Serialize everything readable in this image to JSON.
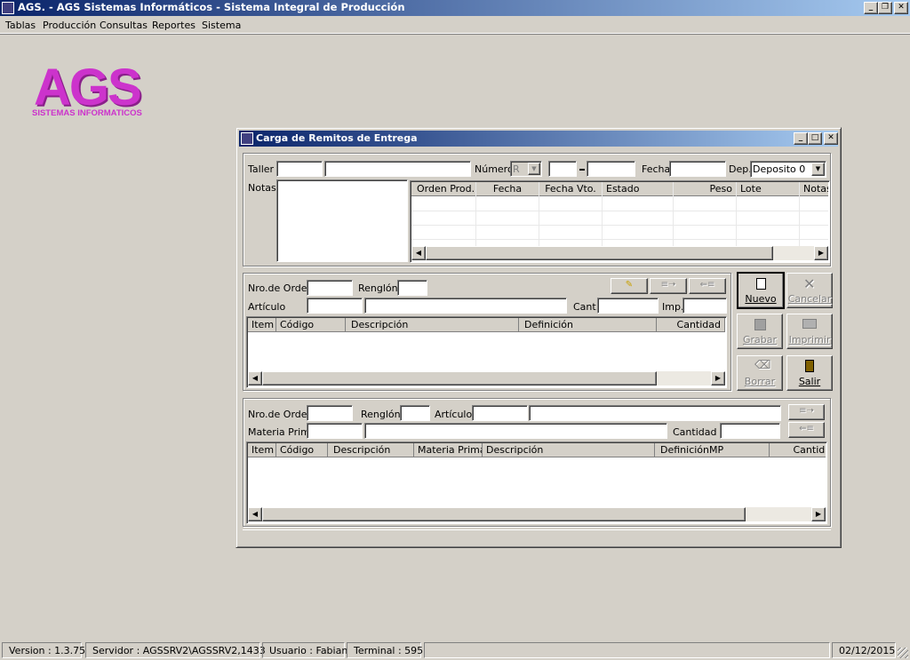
{
  "app": {
    "title": "AGS. - AGS Sistemas Informáticos - Sistema Integral de Producción",
    "logo_text": "AGS",
    "logo_subtext": "SISTEMAS INFORMATICOS"
  },
  "menu": [
    "Tablas",
    "Producción",
    "Consultas",
    "Reportes",
    "Sistema"
  ],
  "dialog": {
    "title": "Carga de Remitos de Entrega",
    "header": {
      "taller_label": "Taller",
      "numero_label": "Número",
      "numero_letter": "R",
      "fecha_label": "Fecha",
      "dep_label": "Dep.",
      "deposito_value": "Deposito 0",
      "notas_label": "Notas"
    },
    "orders_table": {
      "columns": [
        "Orden Prod.",
        "Fecha",
        "Fecha Vto.",
        "Estado",
        "Peso",
        "Lote",
        "Notas"
      ]
    },
    "items_section": {
      "orden_label": "Nro.de Orden",
      "renglon_label": "Renglón",
      "articulo_label": "Artículo",
      "cant_label": "Cant.",
      "imp_label": "Imp.",
      "columns": [
        "Item",
        "Código",
        "Descripción",
        "Definición",
        "Cantidad"
      ]
    },
    "mp_section": {
      "orden_label": "Nro.de Orden",
      "renglon_label": "Renglón",
      "articulo_label": "Artículo",
      "materia_label": "Materia Prima",
      "cantidad_label": "Cantidad",
      "columns": [
        "Item",
        "Código",
        "Descripción",
        "Materia Prima",
        "Descripción",
        "DefiniciónMP",
        "Cantida"
      ]
    },
    "buttons": {
      "nuevo": "Nuevo",
      "cancelar": "Cancelar",
      "grabar": "Grabar",
      "imprimir": "Imprimir",
      "borrar": "Borrar",
      "salir": "Salir"
    }
  },
  "status": {
    "version": "Version : 1.3.75",
    "servidor": "Servidor : AGSSRV2\\AGSSRV2,1433",
    "usuario": "Usuario : Fabian",
    "terminal": "Terminal : 595",
    "date": "02/12/2015"
  },
  "colors": {
    "titlebar_start": "#0a246a",
    "titlebar_end": "#a6caf0",
    "logo": "#cc33cc",
    "face": "#d4d0c8"
  }
}
